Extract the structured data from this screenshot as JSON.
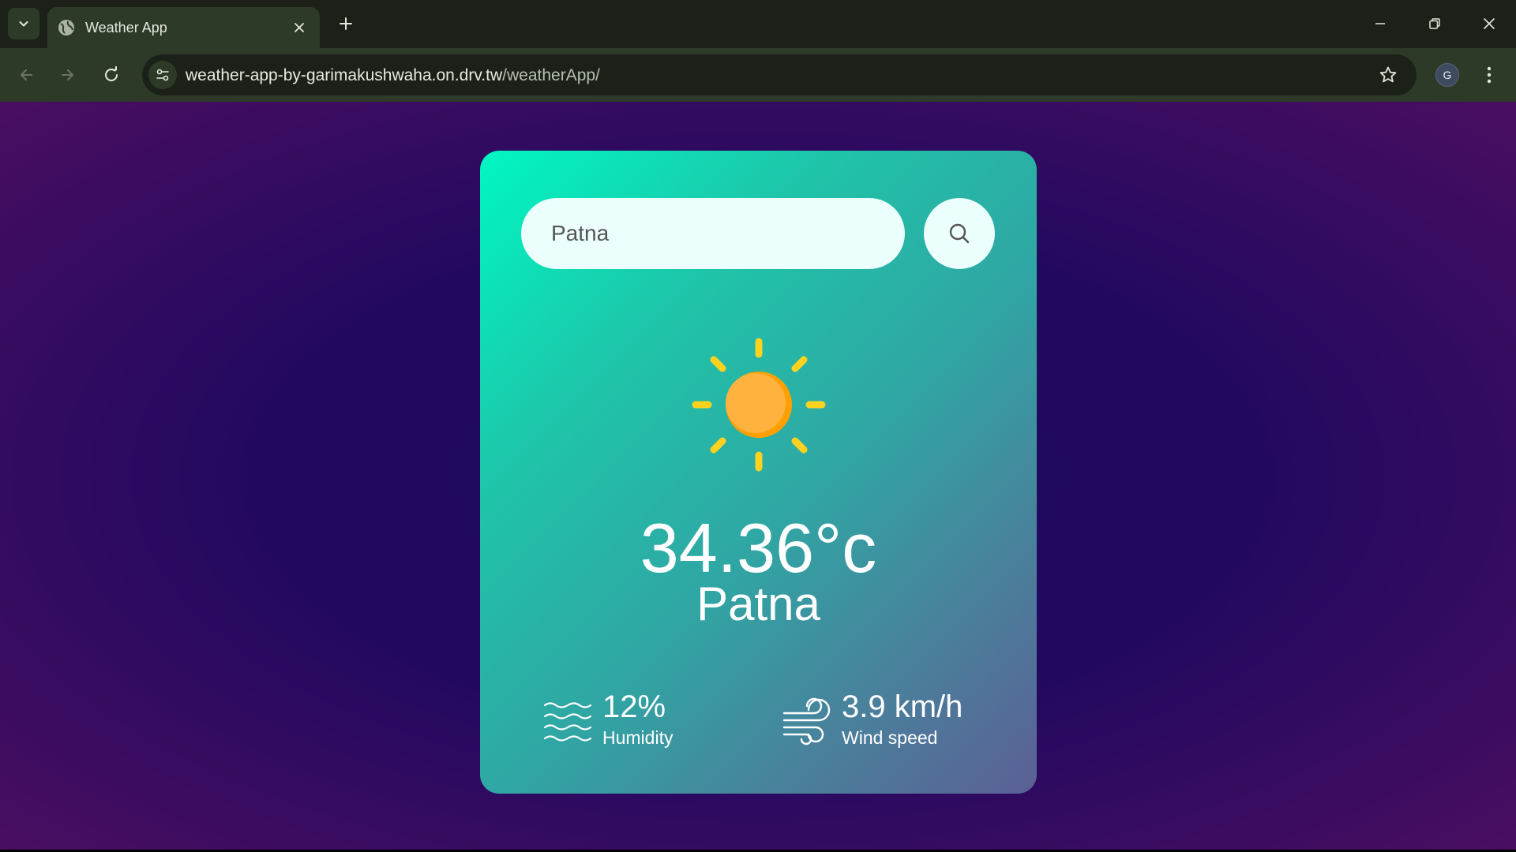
{
  "browser": {
    "tab_title": "Weather App",
    "url_host": "weather-app-by-garimakushwaha.on.drv.tw",
    "url_path": "/weatherApp/",
    "profile_initial": "G",
    "icons": {
      "tab_list": "chevron-down-icon",
      "favicon": "globe-icon",
      "tab_close": "close-icon",
      "new_tab": "plus-icon",
      "minimize": "minimize-icon",
      "restore": "restore-icon",
      "close_window": "close-icon",
      "back": "arrow-left-icon",
      "forward": "arrow-right-icon",
      "reload": "reload-icon",
      "site_info": "tune-icon",
      "bookmark": "star-icon",
      "menu": "more-vert-icon"
    }
  },
  "app": {
    "search": {
      "value": "Patna"
    },
    "weather": {
      "icon": "sun-icon",
      "temperature": "34.36°c",
      "city": "Patna"
    },
    "details": {
      "humidity_value": "12%",
      "humidity_label": "Humidity",
      "wind_value": "3.9 km/h",
      "wind_label": "Wind speed"
    },
    "colors": {
      "card_gradient_start": "#00f7c2",
      "card_gradient_end": "#5b5f95",
      "background": "#21095e",
      "sun_core": "#ffa726",
      "sun_rays": "#ffd21f"
    }
  }
}
